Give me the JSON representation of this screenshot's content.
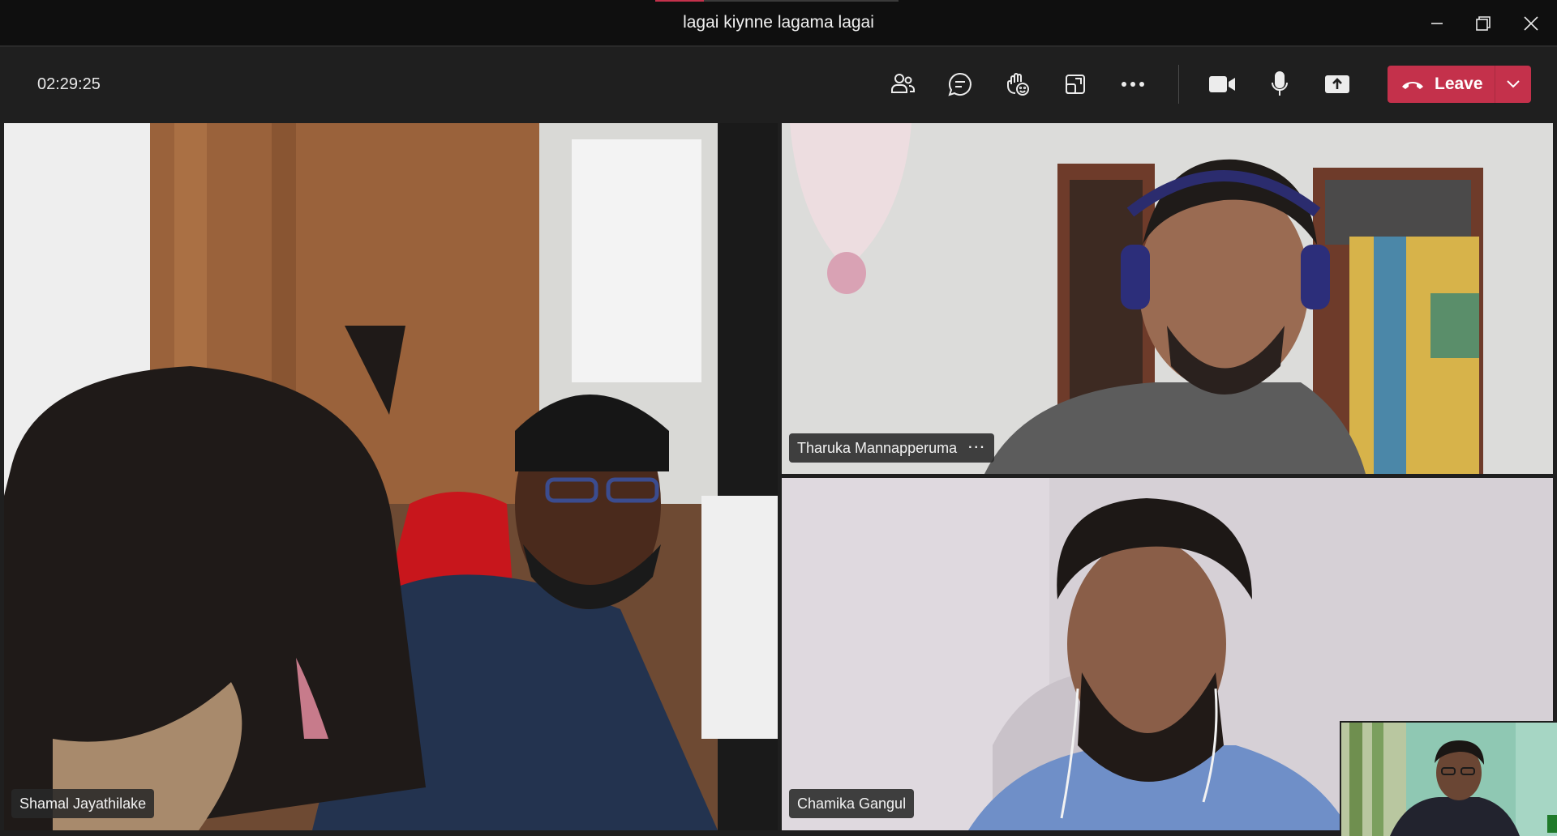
{
  "window": {
    "title": "lagai kiynne lagama lagai"
  },
  "toolbar": {
    "timer": "02:29:25",
    "leave_label": "Leave",
    "buttons": [
      {
        "id": "participants",
        "icon": "people-icon"
      },
      {
        "id": "chat",
        "icon": "chat-icon"
      },
      {
        "id": "reactions",
        "icon": "raise-hand-icon"
      },
      {
        "id": "rooms",
        "icon": "breakout-rooms-icon"
      },
      {
        "id": "more",
        "icon": "more-icon"
      },
      {
        "id": "camera",
        "icon": "camera-icon"
      },
      {
        "id": "mic",
        "icon": "microphone-icon"
      },
      {
        "id": "share",
        "icon": "share-screen-icon"
      }
    ]
  },
  "participants": [
    {
      "name": "Shamal Jayathilake"
    },
    {
      "name": "Tharuka Mannapperuma"
    },
    {
      "name": "Chamika Gangul"
    }
  ],
  "colors": {
    "leave": "#c4314b",
    "toolbar_bg": "#1f1f1f",
    "titlebar_bg": "#0f0f0f"
  }
}
